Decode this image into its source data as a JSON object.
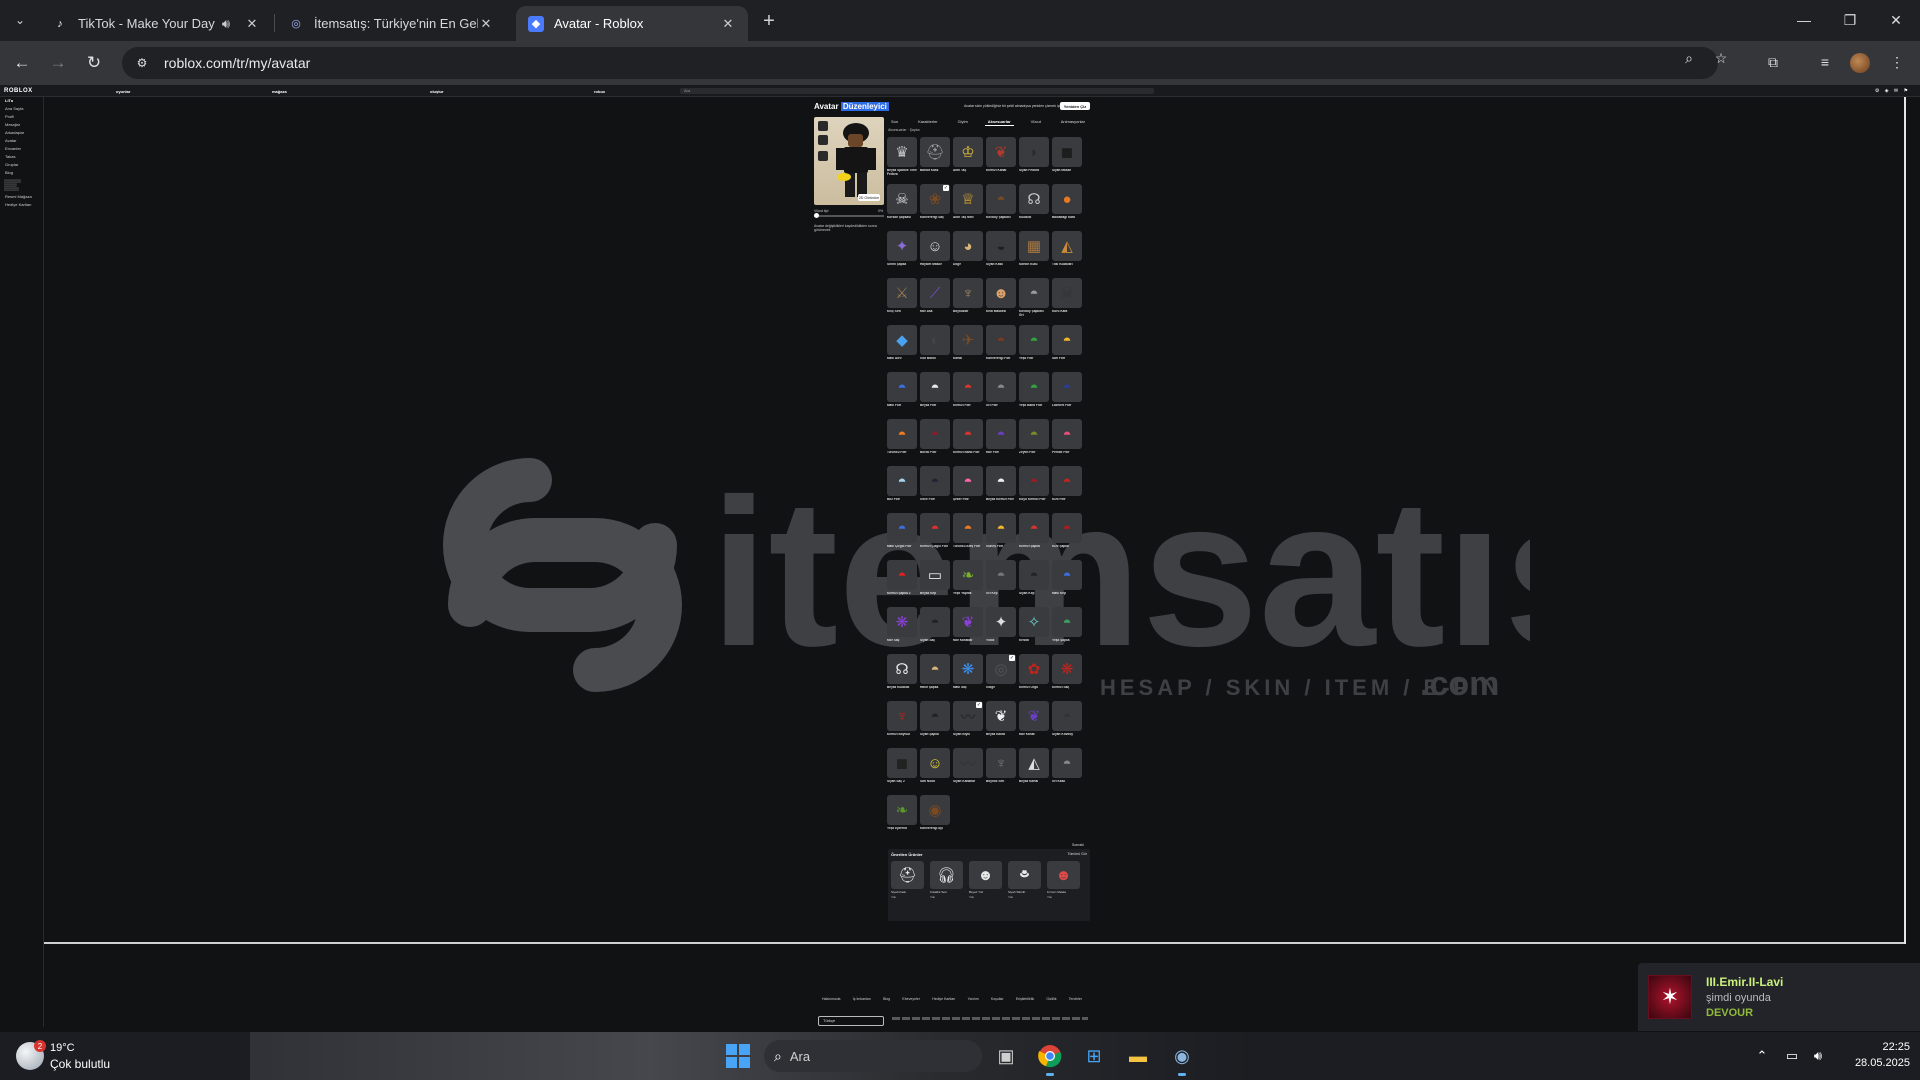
{
  "browser": {
    "tabs": [
      {
        "title": "TikTok - Make Your Day",
        "icon": "tiktok-icon",
        "audio": true
      },
      {
        "title": "İtemsatış: Türkiye'nin En Gelişmi",
        "icon": "itemsatis-icon"
      },
      {
        "title": "Avatar - Roblox",
        "icon": "roblox-icon",
        "active": true
      }
    ],
    "url": "roblox.com/tr/my/avatar"
  },
  "roblox": {
    "logo": "ROBLOX",
    "nav": [
      "oyunlar",
      "mağaza",
      "oluştur",
      "robux"
    ],
    "search_placeholder": "Ara",
    "sidebar": [
      "LiTo",
      "Ana Sayfa",
      "Profil",
      "Mesajlar",
      "Arkadaşlar",
      "Avatar",
      "Envanter",
      "Takas",
      "Gruplar",
      "Blog",
      "Resmi Mağaza",
      "Hediye Kartları"
    ],
    "editor": {
      "title_plain": "Avatar",
      "title_highlight": "Düzenleyici",
      "top_note": "Avatar sizin yüklediğiniz bir şekil almadıysa yeniden çizmek için",
      "top_button": "Yeniden Çiz",
      "tabs": [
        "Son",
        "Karakterler",
        "Giyim",
        "Aksesuarlar",
        "Vücut",
        "Animasyonlar"
      ],
      "subtabs": "Aksesuarlar · Şapka",
      "button_3d": "2D Görünüm",
      "body_type_label": "Vücut tipi",
      "body_type_value": "0%",
      "note": "Avatar değişiklikleri kaydedildikten sonra görünecek"
    },
    "items": [
      "Beyaz Sparkle Time Fedora",
      "Bandit Kask",
      "Altın Taç",
      "Kırmızı Kanat",
      "Siyah Fedora",
      "Siyah Maske",
      "Korsan Şapkası",
      "Kahverengi Saç",
      "Altın Taç Mini",
      "Kovboy Şapkası",
      "Kulaklık",
      "Balkabağı Kafa",
      "Sihirli Şapka",
      "Hayalet Maske",
      "Doge",
      "Siyah Kask",
      "Karton Kutu",
      "Tilki Kulakları",
      "Kılıç Sırtı",
      "Mor Asa",
      "Boynuzlar",
      "Kedi Maskesi",
      "Kovboy Şapkası Gri",
      "Kuru Kafa",
      "Mavi Alev",
      "Göz Bandı",
      "Kartal",
      "Kahverengi Fötr",
      "Yeşil Fötr",
      "Sarı Fötr",
      "Mavi Fötr",
      "Beyaz Fötr",
      "Kırmızı Fötr",
      "Gri Fötr",
      "Yeşil Band Fötr",
      "Lacivert Fötr",
      "Turuncu Fötr",
      "Bordo Fötr",
      "Kırmızı Band Fötr",
      "Mor Fötr",
      "Zeytin Fötr",
      "Pembe Fötr",
      "Buz Fötr",
      "Gece Fötr",
      "Şeker Fötr",
      "Beyaz Kırmızı Fötr",
      "Koyu Kırmızı Fötr",
      "Kızıl Fötr",
      "Mavi Çizgili Fötr",
      "Kırmızı Çizgili Fötr",
      "Turuncu Ateş Fötr",
      "Güneş Fötr",
      "Kırmızı Şapka",
      "Kızıl Şapka",
      "Kırmızı Şapka 2",
      "Beyaz Kep",
      "Yeşil Yaprak",
      "Gri Kep",
      "Siyah Kep",
      "Mavi Kep",
      "Mor Saç",
      "Siyah Saç",
      "Mor Kanatlar",
      "Yıldız",
      "Kristal",
      "Yeşil Şapka",
      "Beyaz Kulaklık",
      "Hasır Şapka",
      "Mavi Saç",
      "Gölge",
      "Kırmızı Örgü",
      "Kırmızı Saç",
      "Kırmızı Boynuz",
      "Siyah Şapka",
      "Siyah Bıyık",
      "Beyaz Kanat",
      "Mor Kanat",
      "Siyah Kovboy",
      "Siyah Saç 2",
      "Sarı Noob",
      "Siyah Kanatlar",
      "Boynuz Seti",
      "Beyaz Kartal",
      "Gri Kask",
      "Yeşil Ejderha",
      "Kahverengi Ayı"
    ],
    "more_label": "Sonraki",
    "recommended": {
      "title": "Önerilen Ürünler",
      "see_all": "Tümünü Gör",
      "items": [
        {
          "name": "Siyah Kask",
          "price": "Yok"
        },
        {
          "name": "Kulaklık Seti",
          "price": "Yok"
        },
        {
          "name": "Beyaz Yüz",
          "price": "Yok"
        },
        {
          "name": "Siyah Silindir",
          "price": "Yok"
        },
        {
          "name": "Kırmızı Maske",
          "price": "Yok"
        }
      ]
    },
    "footer": {
      "links": [
        "Hakkımızda",
        "İş İmkanları",
        "Blog",
        "Ebeveynler",
        "Hediye Kartları",
        "Yardım",
        "Koşullar",
        "Erişilebilirlik",
        "Gizlilik",
        "Tercihler"
      ],
      "language": "Türkçe"
    }
  },
  "notification": {
    "name": "III.Emir.II-Lavi",
    "status": "şimdi oyunda",
    "game": "DEVOUR"
  },
  "taskbar": {
    "weather_temp": "19°C",
    "weather_desc": "Çok bulutlu",
    "weather_badge": "2",
    "search_placeholder": "Ara",
    "time": "22:25",
    "date": "28.05.2025"
  },
  "watermark": {
    "brand": "itemsatış",
    "tagline": "HESAP / SKIN / ITEM / E-PIN",
    "suffix": ".com"
  },
  "colors": {
    "page_bg": "#111214",
    "accent_blue": "#2e6be6",
    "notif_name": "#c9f07b",
    "notif_game": "#90ba3c"
  }
}
